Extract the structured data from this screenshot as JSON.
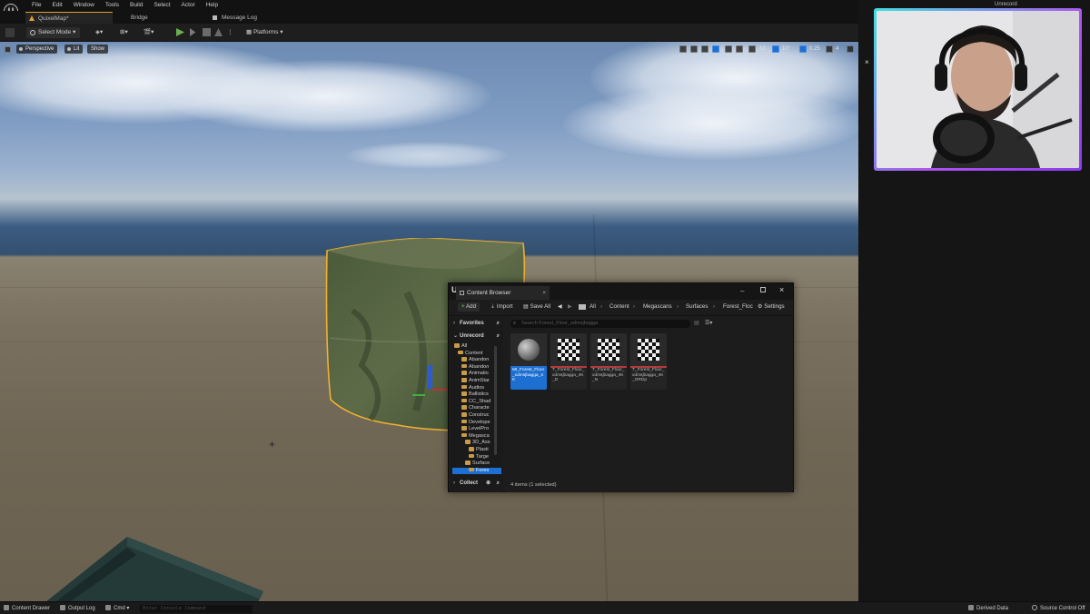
{
  "menu": {
    "items": [
      "File",
      "Edit",
      "Window",
      "Tools",
      "Build",
      "Select",
      "Actor",
      "Help"
    ]
  },
  "top_right": {
    "user": "Unrecord"
  },
  "tabs": {
    "map": "QuixelMap*",
    "bridge": "Bridge",
    "message_log": "Message Log"
  },
  "toolbar": {
    "select_mode": "Select Mode",
    "platforms": "Platforms"
  },
  "viewport": {
    "perspective": "Perspective",
    "lit": "Lit",
    "show": "Show",
    "grid_snap": "10",
    "rotation_snap": "10°",
    "scale_snap": "0.25",
    "camera_speed": "4"
  },
  "content_browser": {
    "title": "Content Browser",
    "add": "Add",
    "import": "Import",
    "save_all": "Save All",
    "path": [
      "All",
      "Content",
      "Megascans",
      "Surfaces",
      "Forest_Floc"
    ],
    "settings": "Settings",
    "favorites": "Favorites",
    "project": "Unrecord",
    "collections": "Collect",
    "search_placeholder": "Search Forest_Floor_xdmsjbagga",
    "tree": [
      {
        "label": "All",
        "indent": 0
      },
      {
        "label": "Content",
        "indent": 1
      },
      {
        "label": "Abandon",
        "indent": 2
      },
      {
        "label": "Abandon",
        "indent": 2
      },
      {
        "label": "Animatio",
        "indent": 2
      },
      {
        "label": "AnimStar",
        "indent": 2
      },
      {
        "label": "Audios",
        "indent": 2
      },
      {
        "label": "Ballistics",
        "indent": 2
      },
      {
        "label": "CC_Shad",
        "indent": 2
      },
      {
        "label": "Characte",
        "indent": 2
      },
      {
        "label": "Construc",
        "indent": 2
      },
      {
        "label": "Develope",
        "indent": 2
      },
      {
        "label": "LevelPro",
        "indent": 2
      },
      {
        "label": "Megasca",
        "indent": 2
      },
      {
        "label": "3D_Ass",
        "indent": 3
      },
      {
        "label": "Plasti",
        "indent": 4
      },
      {
        "label": "Targe",
        "indent": 4
      },
      {
        "label": "Surface",
        "indent": 3
      },
      {
        "label": "Fores",
        "indent": 4
      }
    ],
    "assets": [
      {
        "name": "MI_Forest_Floor_xdmsjbagga_4K",
        "kind": "material",
        "selected": true
      },
      {
        "name": "T_Forest_Floor_xdmsjbagga_4K_D",
        "kind": "texture",
        "selected": false
      },
      {
        "name": "T_Forest_Floor_xdmsjbagga_4K_N",
        "kind": "texture",
        "selected": false
      },
      {
        "name": "T_Forest_Floor_xdmsjbagga_4K_ORDp",
        "kind": "texture",
        "selected": false
      }
    ],
    "status": "4 items (1 selected)"
  },
  "statusbar": {
    "content_drawer": "Content Drawer",
    "output_log": "Output Log",
    "cmd": "Cmd",
    "console_placeholder": "Enter Console Command",
    "derived_data": "Derived Data",
    "source_control": "Source Control Off"
  },
  "colors": {
    "accent_orange": "#e0a030",
    "selection_blue": "#1d6fd1",
    "cam_border_cyan": "#3fe0e0",
    "cam_border_purple": "#b050f0"
  }
}
